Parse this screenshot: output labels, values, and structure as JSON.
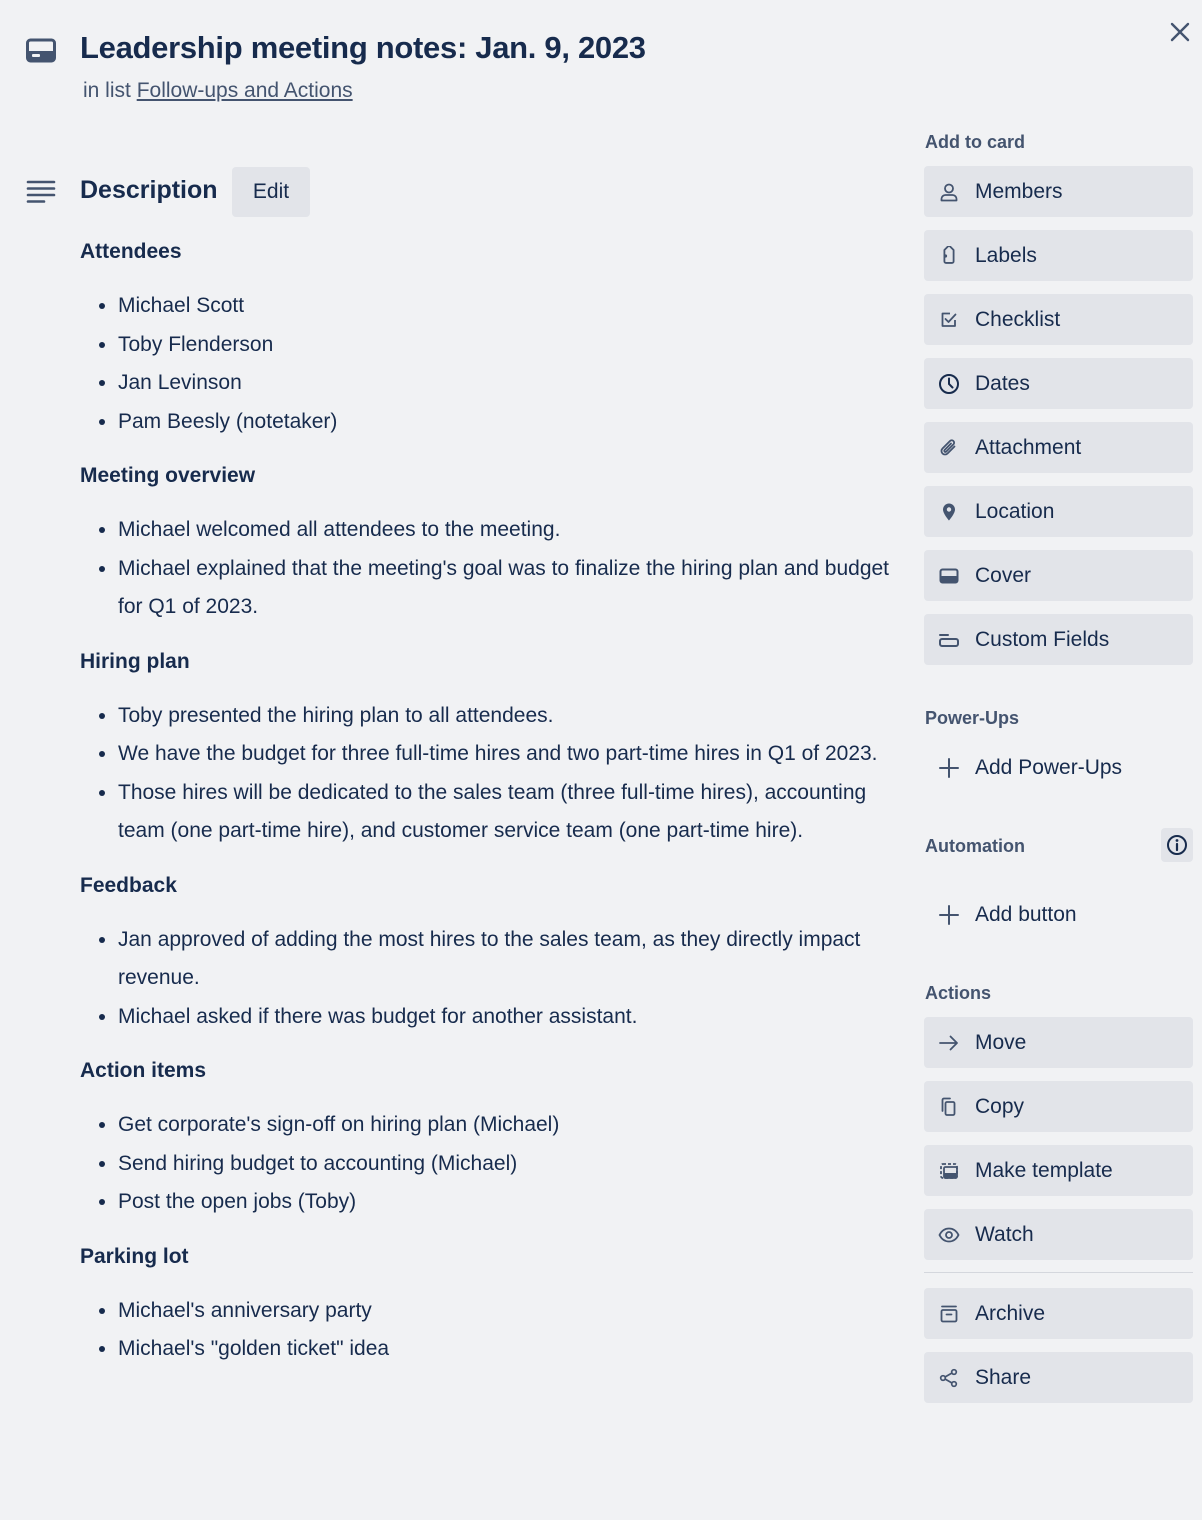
{
  "card": {
    "title": "Leadership meeting notes: Jan. 9, 2023",
    "list_prefix": "in list ",
    "list_name": "Follow-ups and Actions"
  },
  "description": {
    "heading": "Description",
    "edit_label": "Edit",
    "sections": [
      {
        "heading": "Attendees",
        "items": [
          "Michael Scott",
          "Toby Flenderson",
          "Jan Levinson",
          "Pam Beesly (notetaker)"
        ]
      },
      {
        "heading": "Meeting overview",
        "items": [
          "Michael welcomed all attendees to the meeting.",
          "Michael explained that the meeting's goal was to finalize the hiring plan and budget for Q1 of 2023."
        ]
      },
      {
        "heading": "Hiring plan",
        "items": [
          "Toby presented the hiring plan to all attendees.",
          "We have the budget for three full-time hires and two part-time hires in Q1 of 2023.",
          "Those hires will be dedicated to the sales team (three full-time hires), accounting team (one part-time hire), and customer service team (one part-time hire)."
        ]
      },
      {
        "heading": "Feedback",
        "items": [
          "Jan approved of adding the most hires to the sales team, as they directly impact revenue.",
          "Michael asked if there was budget for another assistant."
        ]
      },
      {
        "heading": "Action items",
        "items": [
          "Get corporate's sign-off on hiring plan (Michael)",
          "Send hiring budget to accounting (Michael)",
          "Post the open jobs (Toby)"
        ]
      },
      {
        "heading": "Parking lot",
        "items": [
          "Michael's anniversary party",
          "Michael's \"golden ticket\" idea"
        ]
      }
    ]
  },
  "sidebar": {
    "add_to_card": {
      "heading": "Add to card",
      "items": [
        {
          "label": "Members",
          "icon": "person-icon"
        },
        {
          "label": "Labels",
          "icon": "tag-icon"
        },
        {
          "label": "Checklist",
          "icon": "checkbox-icon"
        },
        {
          "label": "Dates",
          "icon": "clock-icon"
        },
        {
          "label": "Attachment",
          "icon": "paperclip-icon"
        },
        {
          "label": "Location",
          "icon": "location-pin-icon"
        },
        {
          "label": "Cover",
          "icon": "cover-icon"
        },
        {
          "label": "Custom Fields",
          "icon": "custom-fields-icon"
        }
      ]
    },
    "power_ups": {
      "heading": "Power-Ups",
      "add_label": "Add Power-Ups"
    },
    "automation": {
      "heading": "Automation",
      "add_label": "Add button"
    },
    "actions": {
      "heading": "Actions",
      "items": [
        {
          "label": "Move",
          "icon": "arrow-right-icon"
        },
        {
          "label": "Copy",
          "icon": "copy-icon"
        },
        {
          "label": "Make template",
          "icon": "template-icon"
        },
        {
          "label": "Watch",
          "icon": "eye-icon"
        }
      ],
      "secondary_items": [
        {
          "label": "Archive",
          "icon": "archive-icon"
        },
        {
          "label": "Share",
          "icon": "share-icon"
        }
      ]
    }
  },
  "colors": {
    "background": "#f1f2f4",
    "button_bg": "#e2e4e9",
    "text": "#172b4d",
    "subtle_text": "#44546f"
  }
}
